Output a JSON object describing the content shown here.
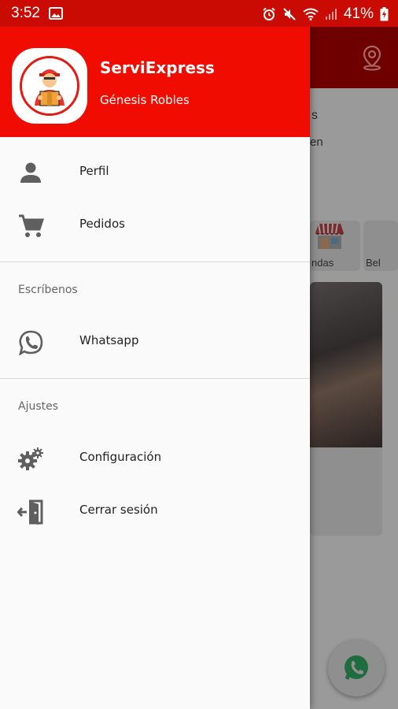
{
  "status_bar": {
    "time": "3:52",
    "battery": "41%"
  },
  "colors": {
    "header": "#f00c00",
    "status_bar": "#c90b04",
    "icon": "#5f5f5f",
    "scrim": "#9a9a9a"
  },
  "drawer": {
    "app_name": "ServiExpress",
    "user_name": "Génesis Robles",
    "items_main": [
      {
        "label": "Perfil",
        "icon": "person-icon"
      },
      {
        "label": "Pedidos",
        "icon": "cart-icon"
      }
    ],
    "section_contact": "Escríbenos",
    "items_contact": [
      {
        "label": "Whatsapp",
        "icon": "whatsapp-icon"
      }
    ],
    "section_settings": "Ajustes",
    "items_settings": [
      {
        "label": "Configuración",
        "icon": "gears-icon"
      },
      {
        "label": "Cerrar sesión",
        "icon": "logout-door-icon"
      }
    ]
  },
  "background": {
    "text_1": "s",
    "text_2": "en",
    "category_1": "ndas",
    "category_2": "Bel"
  }
}
